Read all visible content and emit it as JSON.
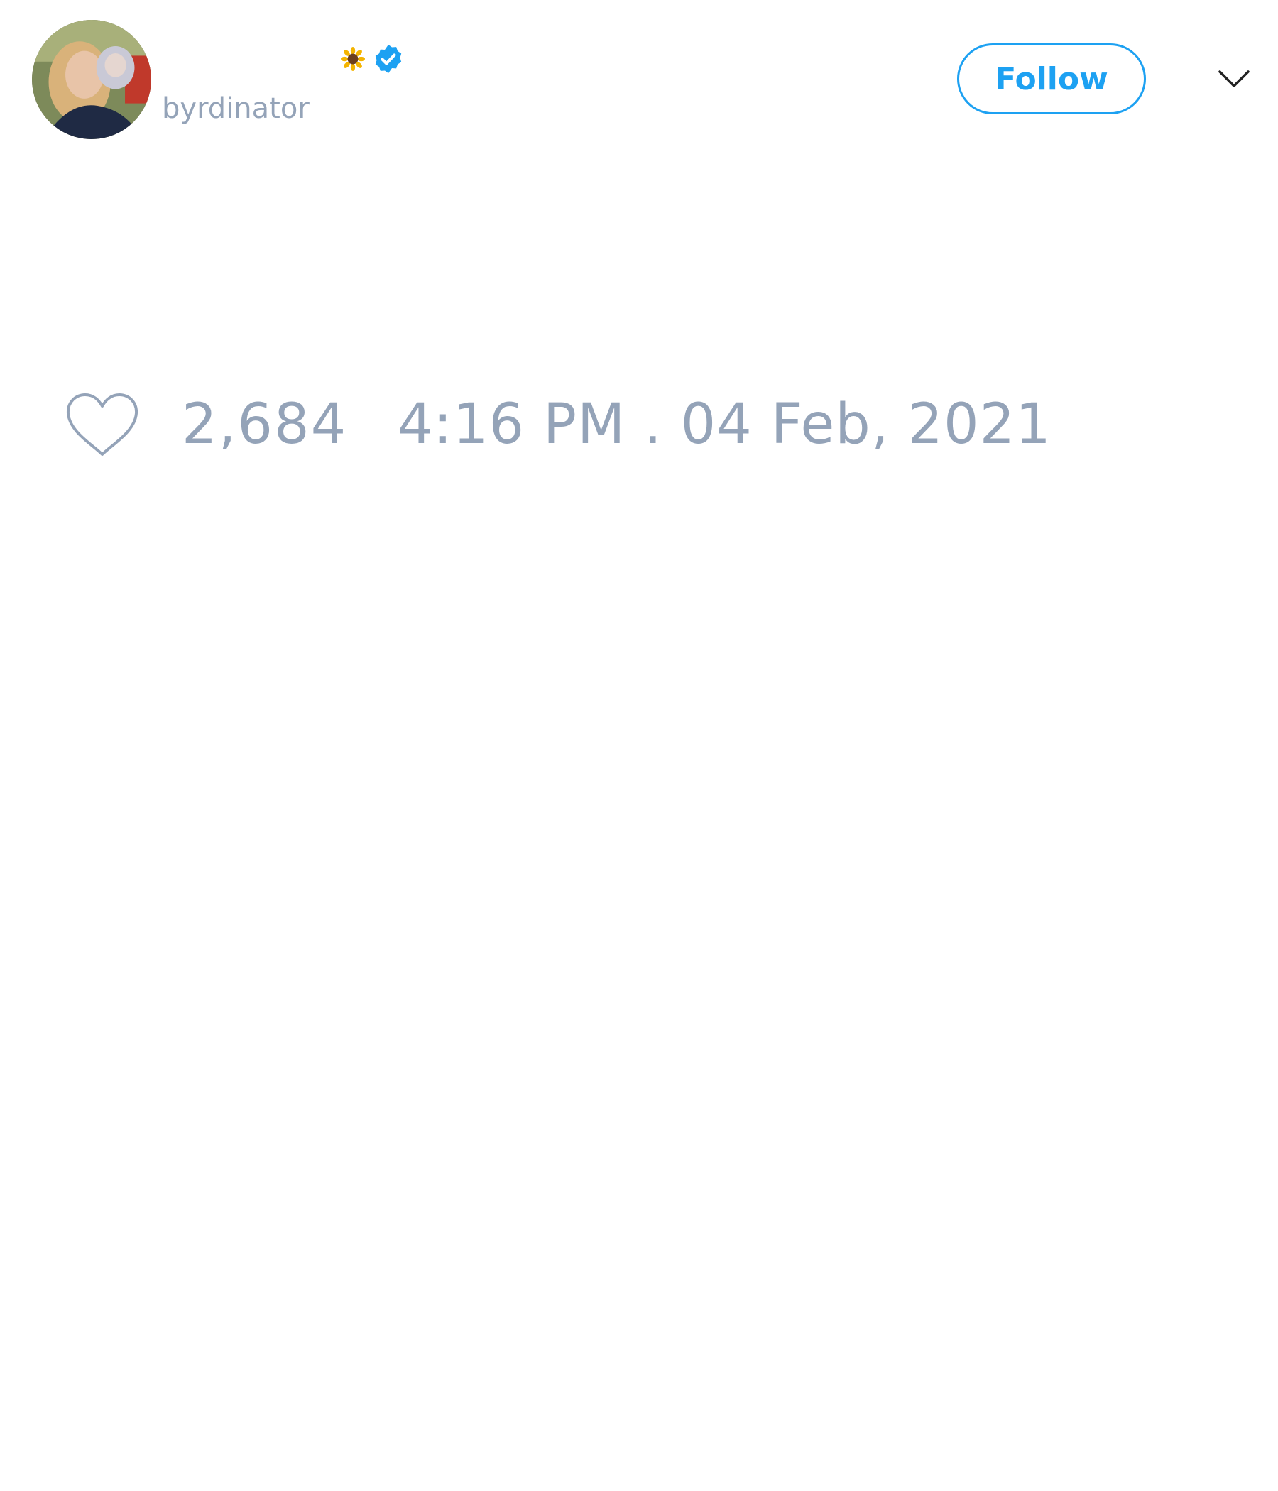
{
  "tweet": {
    "author": {
      "handle": "byrdinator",
      "emoji_icon": "sunflower-icon",
      "verified_icon": "verified-badge-icon",
      "avatar": "profile-photo"
    },
    "follow_button": {
      "label": "Follow"
    },
    "menu_icon": "chevron-down-icon",
    "like_icon": "heart-outline-icon",
    "like_count": "2,684",
    "timestamp": "4:16 PM . 04 Feb, 2021"
  },
  "colors": {
    "accent": "#1da1f2",
    "muted_text": "#94a3b8",
    "background": "#ffffff"
  }
}
